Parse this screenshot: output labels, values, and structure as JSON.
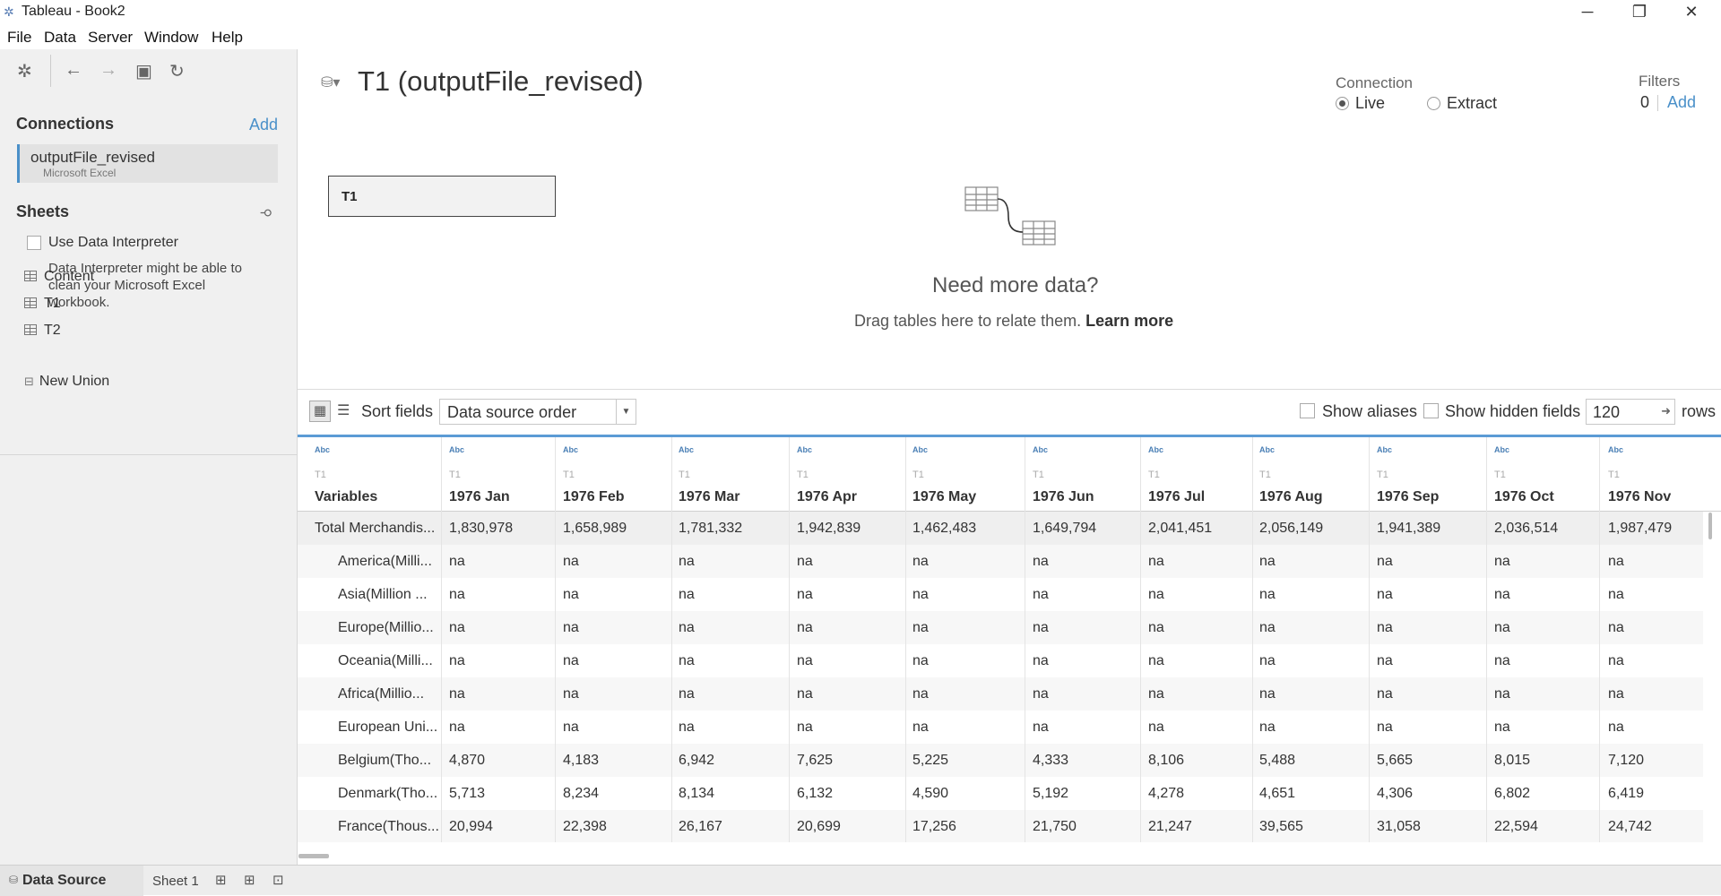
{
  "window": {
    "title": "Tableau - Book2"
  },
  "menu": [
    "File",
    "Data",
    "Server",
    "Window",
    "Help"
  ],
  "left": {
    "connections_heading": "Connections",
    "add_label": "Add",
    "connection": {
      "name": "outputFile_revised",
      "type": "Microsoft Excel"
    },
    "sheets_heading": "Sheets",
    "use_interpreter": "Use Data Interpreter",
    "interpreter_desc": "Data Interpreter might be able to clean your Microsoft Excel workbook.",
    "sheets": [
      "Content",
      "T1",
      "T2"
    ],
    "new_union": "New Union"
  },
  "canvas": {
    "datasource_title": "T1 (outputFile_revised)",
    "connection_label": "Connection",
    "live_label": "Live",
    "extract_label": "Extract",
    "filters_label": "Filters",
    "filters_count": "0",
    "filters_add": "Add",
    "table_name": "T1",
    "need_more": "Need more data?",
    "drag_text": "Drag tables here to relate them.",
    "learn_more": "Learn more"
  },
  "grid_toolbar": {
    "sort_fields": "Sort fields",
    "sort_value": "Data source order",
    "show_aliases": "Show aliases",
    "show_hidden": "Show hidden fields",
    "rows_value": "120",
    "rows_label": "rows"
  },
  "grid": {
    "columns": [
      {
        "type": "Abc",
        "table": "T1",
        "name": "Variables"
      },
      {
        "type": "Abc",
        "table": "T1",
        "name": "1976 Jan"
      },
      {
        "type": "Abc",
        "table": "T1",
        "name": "1976 Feb"
      },
      {
        "type": "Abc",
        "table": "T1",
        "name": "1976 Mar"
      },
      {
        "type": "Abc",
        "table": "T1",
        "name": "1976 Apr"
      },
      {
        "type": "Abc",
        "table": "T1",
        "name": "1976 May"
      },
      {
        "type": "Abc",
        "table": "T1",
        "name": "1976 Jun"
      },
      {
        "type": "Abc",
        "table": "T1",
        "name": "1976 Jul"
      },
      {
        "type": "Abc",
        "table": "T1",
        "name": "1976 Aug"
      },
      {
        "type": "Abc",
        "table": "T1",
        "name": "1976 Sep"
      },
      {
        "type": "Abc",
        "table": "T1",
        "name": "1976 Oct"
      },
      {
        "type": "Abc",
        "table": "T1",
        "name": "1976 Nov"
      }
    ],
    "rows": [
      [
        "Total Merchandis...",
        "1,830,978",
        "1,658,989",
        "1,781,332",
        "1,942,839",
        "1,462,483",
        "1,649,794",
        "2,041,451",
        "2,056,149",
        "1,941,389",
        "2,036,514",
        "1,987,479"
      ],
      [
        "America(Milli...",
        "na",
        "na",
        "na",
        "na",
        "na",
        "na",
        "na",
        "na",
        "na",
        "na",
        "na"
      ],
      [
        "Asia(Million ...",
        "na",
        "na",
        "na",
        "na",
        "na",
        "na",
        "na",
        "na",
        "na",
        "na",
        "na"
      ],
      [
        "Europe(Millio...",
        "na",
        "na",
        "na",
        "na",
        "na",
        "na",
        "na",
        "na",
        "na",
        "na",
        "na"
      ],
      [
        "Oceania(Milli...",
        "na",
        "na",
        "na",
        "na",
        "na",
        "na",
        "na",
        "na",
        "na",
        "na",
        "na"
      ],
      [
        "Africa(Millio...",
        "na",
        "na",
        "na",
        "na",
        "na",
        "na",
        "na",
        "na",
        "na",
        "na",
        "na"
      ],
      [
        "European Uni...",
        "na",
        "na",
        "na",
        "na",
        "na",
        "na",
        "na",
        "na",
        "na",
        "na",
        "na"
      ],
      [
        "Belgium(Tho...",
        "4,870",
        "4,183",
        "6,942",
        "7,625",
        "5,225",
        "4,333",
        "8,106",
        "5,488",
        "5,665",
        "8,015",
        "7,120"
      ],
      [
        "Denmark(Tho...",
        "5,713",
        "8,234",
        "8,134",
        "6,132",
        "4,590",
        "5,192",
        "4,278",
        "4,651",
        "4,306",
        "6,802",
        "6,419"
      ],
      [
        "France(Thous...",
        "20,994",
        "22,398",
        "26,167",
        "20,699",
        "17,256",
        "21,750",
        "21,247",
        "39,565",
        "31,058",
        "22,594",
        "24,742"
      ]
    ]
  },
  "bottom_tabs": {
    "data_source": "Data Source",
    "sheet1": "Sheet 1"
  }
}
